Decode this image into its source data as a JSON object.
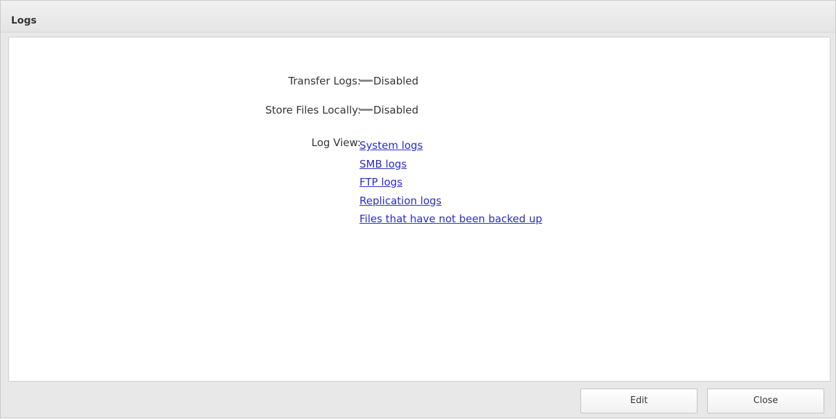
{
  "window": {
    "title": "Logs"
  },
  "settings": [
    {
      "label": "Transfer Logs:",
      "value": "Disabled"
    },
    {
      "label": "Store Files Locally:",
      "value": "Disabled"
    }
  ],
  "log_view": {
    "label": "Log View:",
    "links": [
      "System logs",
      "SMB logs",
      "FTP logs",
      "Replication logs",
      "Files that have not been backed up"
    ]
  },
  "footer": {
    "edit_label": "Edit",
    "close_label": "Close"
  },
  "colors": {
    "link": "#2a2acc",
    "status_dash": "#888888"
  }
}
